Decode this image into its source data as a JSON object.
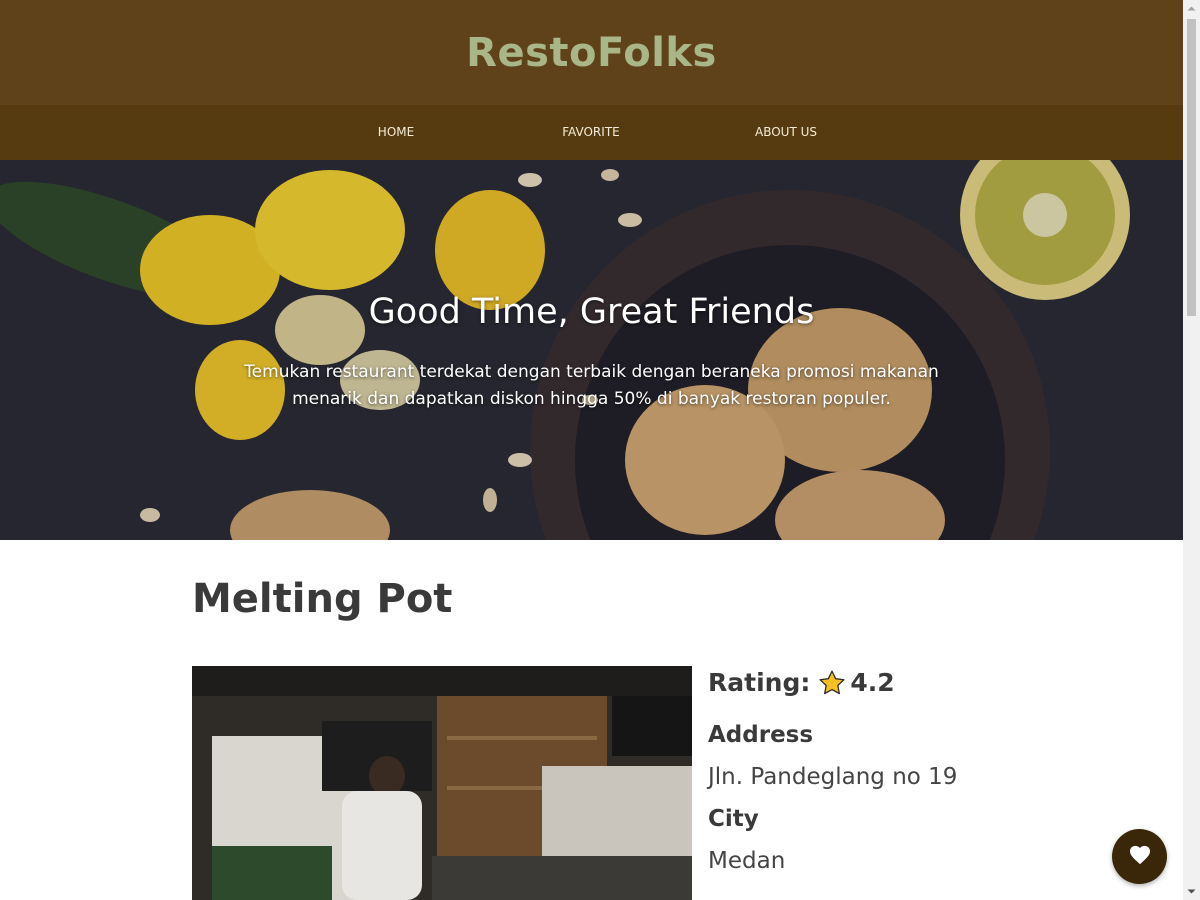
{
  "brand": "RestoFolks",
  "nav": {
    "items": [
      {
        "label": "HOME"
      },
      {
        "label": "FAVORITE"
      },
      {
        "label": "ABOUT US"
      }
    ]
  },
  "hero": {
    "title": "Good Time, Great Friends",
    "subtitle": "Temukan restaurant terdekat dengan terbaik dengan beraneka promosi makanan menarik dan dapatkan diskon hingga 50% di banyak restoran populer."
  },
  "restaurant": {
    "name": "Melting Pot",
    "rating_label": "Rating:",
    "rating_value": "4.2",
    "address_heading": "Address",
    "address": "Jln. Pandeglang no 19",
    "city_heading": "City",
    "city": "Medan"
  },
  "icons": {
    "rating": "star-icon",
    "favorite": "heart-icon"
  },
  "colors": {
    "header": "#5f421a",
    "nav": "#573b10",
    "brand_text": "#a9b687",
    "fav_button": "#3a2709",
    "star": "#f5c022"
  }
}
